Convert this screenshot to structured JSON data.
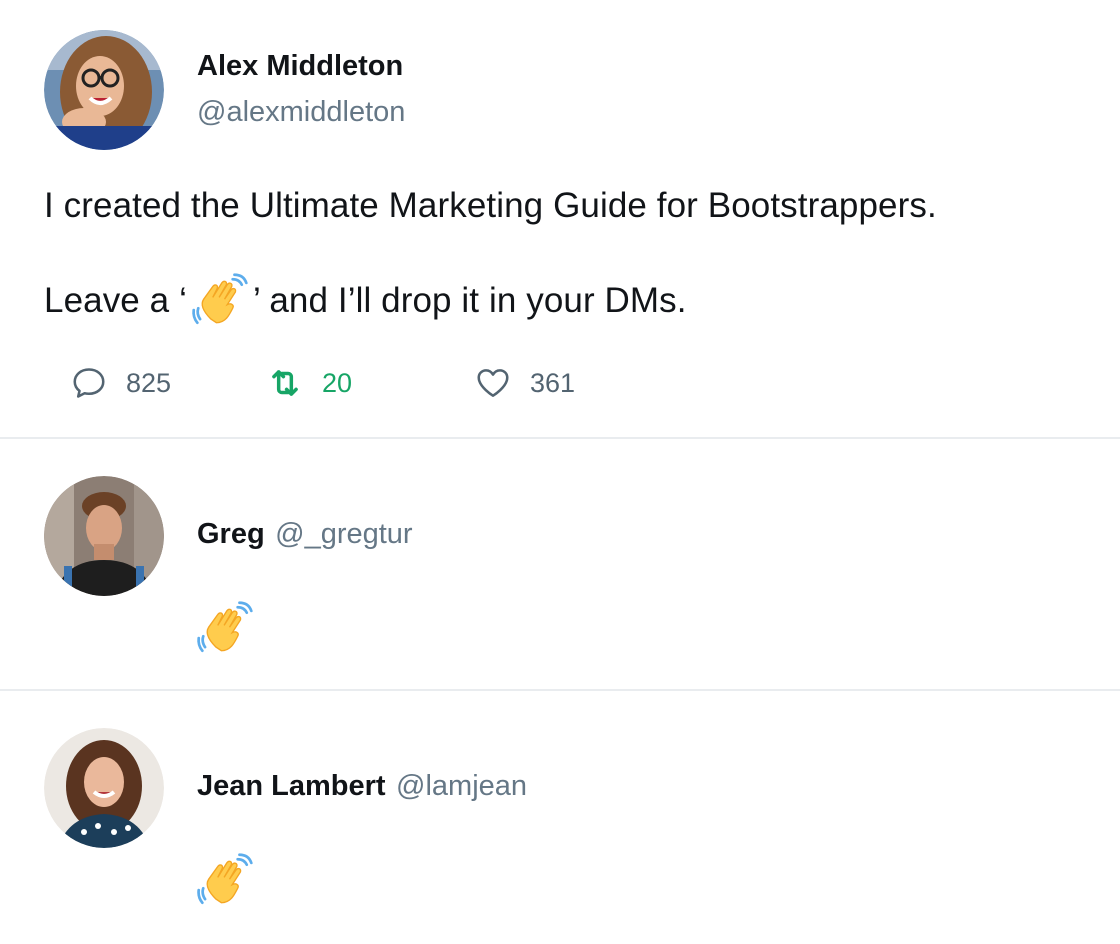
{
  "tweet": {
    "author": {
      "name": "Alex Middleton",
      "handle": "@alexmiddleton"
    },
    "text_line1": "I created the Ultimate Marketing Guide for Bootstrappers.",
    "text_line2_before": "Leave a ‘",
    "text_line2_emoji": "waving-hand-emoji",
    "text_line2_after": "’ and I’ll drop it in your DMs.",
    "actions": {
      "replies": "825",
      "retweets": "20",
      "likes": "361",
      "reply_icon": "speech-bubble-icon",
      "retweet_icon": "retweet-icon",
      "like_icon": "heart-icon",
      "retweet_color": "#17a566"
    }
  },
  "replies": [
    {
      "name": "Greg",
      "handle": "@_gregtur",
      "content_emoji": "waving-hand-emoji"
    },
    {
      "name": "Jean Lambert",
      "handle": "@lamjean",
      "content_emoji": "waving-hand-emoji"
    }
  ]
}
